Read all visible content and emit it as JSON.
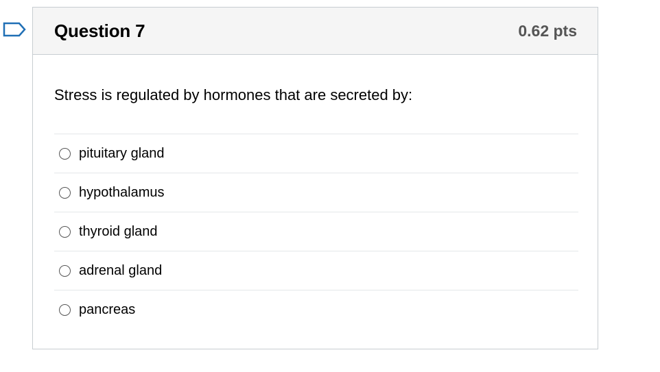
{
  "question": {
    "title": "Question 7",
    "points": "0.62 pts",
    "text": "Stress is regulated by hormones that are secreted by:",
    "answers": [
      {
        "label": "pituitary gland"
      },
      {
        "label": "hypothalamus"
      },
      {
        "label": "thyroid gland"
      },
      {
        "label": "adrenal gland"
      },
      {
        "label": "pancreas"
      }
    ]
  },
  "colors": {
    "flag": "#1f6fb5",
    "header_bg": "#f5f5f5",
    "border": "#c7cdd1"
  },
  "icons": {
    "flag": "flag-question-icon"
  }
}
